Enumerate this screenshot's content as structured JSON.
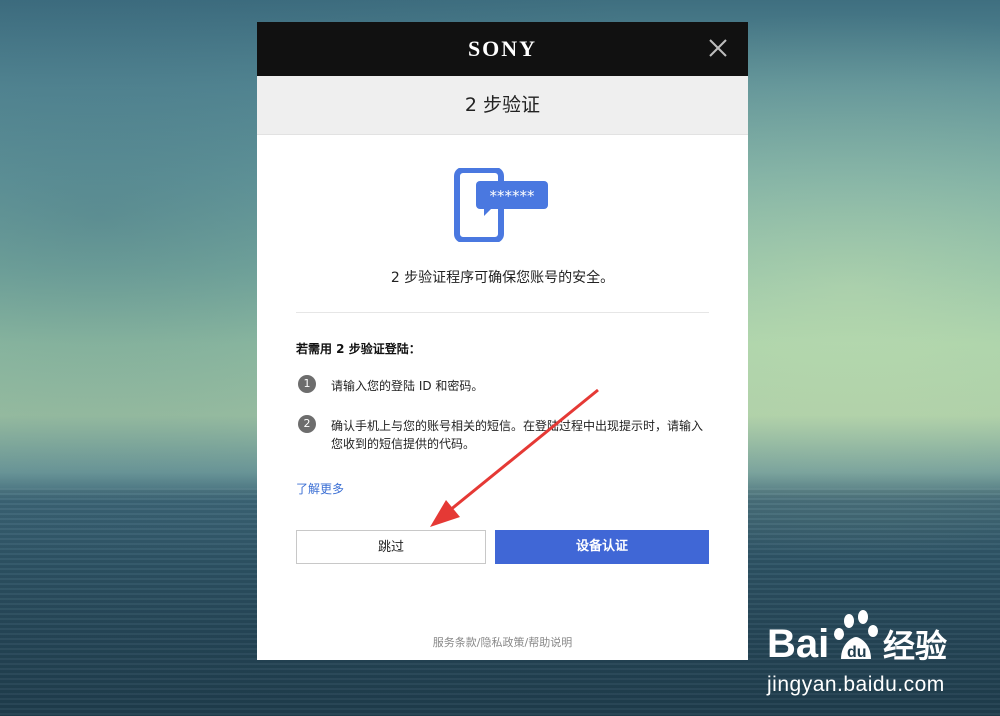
{
  "brand": {
    "logo": "SONY"
  },
  "dialog": {
    "title": "2 步验证",
    "icon_text": "******",
    "intro": "2 步验证程序可确保您账号的安全。",
    "section_title": "若需用 2 步验证登陆：",
    "steps": [
      {
        "num": "1",
        "text": "请输入您的登陆 ID 和密码。"
      },
      {
        "num": "2",
        "text": "确认手机上与您的账号相关的短信。在登陆过程中出现提示时，请输入您收到的短信提供的代码。"
      }
    ],
    "learn_more": "了解更多",
    "skip_label": "跳过",
    "device_auth_label": "设备认证",
    "footer": "服务条款/隐私政策/帮助说明"
  },
  "watermark": {
    "brand": "Baidu经验",
    "url": "jingyan.baidu.com"
  },
  "colors": {
    "accent": "#4067d6",
    "icon": "#4a78e0",
    "header": "#111111",
    "arrow": "#e53935"
  }
}
